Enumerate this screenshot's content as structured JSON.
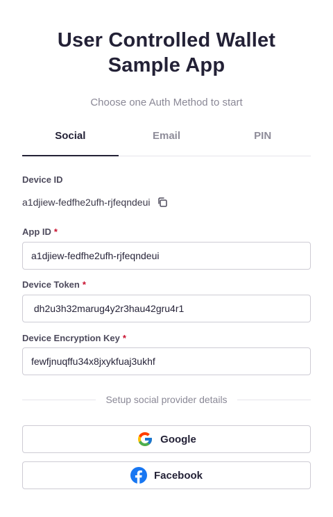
{
  "header": {
    "title_line1": "User Controlled Wallet",
    "title_line2": "Sample App",
    "subtitle": "Choose one Auth Method to start"
  },
  "tabs": [
    {
      "label": "Social",
      "active": true
    },
    {
      "label": "Email",
      "active": false
    },
    {
      "label": "PIN",
      "active": false
    }
  ],
  "device": {
    "label": "Device ID",
    "value": "a1djiew-fedfhe2ufh-rjfeqndeui",
    "copy_icon": "copy-icon"
  },
  "fields": {
    "app_id": {
      "label": "App ID",
      "required_mark": "*",
      "value": "a1djiew-fedfhe2ufh-rjfeqndeui"
    },
    "device_token": {
      "label": "Device Token",
      "required_mark": "*",
      "value": " dh2u3h32marug4y2r3hau42gru4r1"
    },
    "device_encryption_key": {
      "label": "Device Encryption Key",
      "required_mark": "*",
      "value": "fewfjnuqffu34x8jxykfuaj3ukhf"
    }
  },
  "social": {
    "divider_text": "Setup social provider details",
    "google_label": "Google",
    "facebook_label": "Facebook"
  },
  "colors": {
    "text_dark": "#232136",
    "muted": "#8a8896",
    "required": "#c8102e",
    "border": "#cdcbd4",
    "facebook_blue": "#1877f2"
  }
}
